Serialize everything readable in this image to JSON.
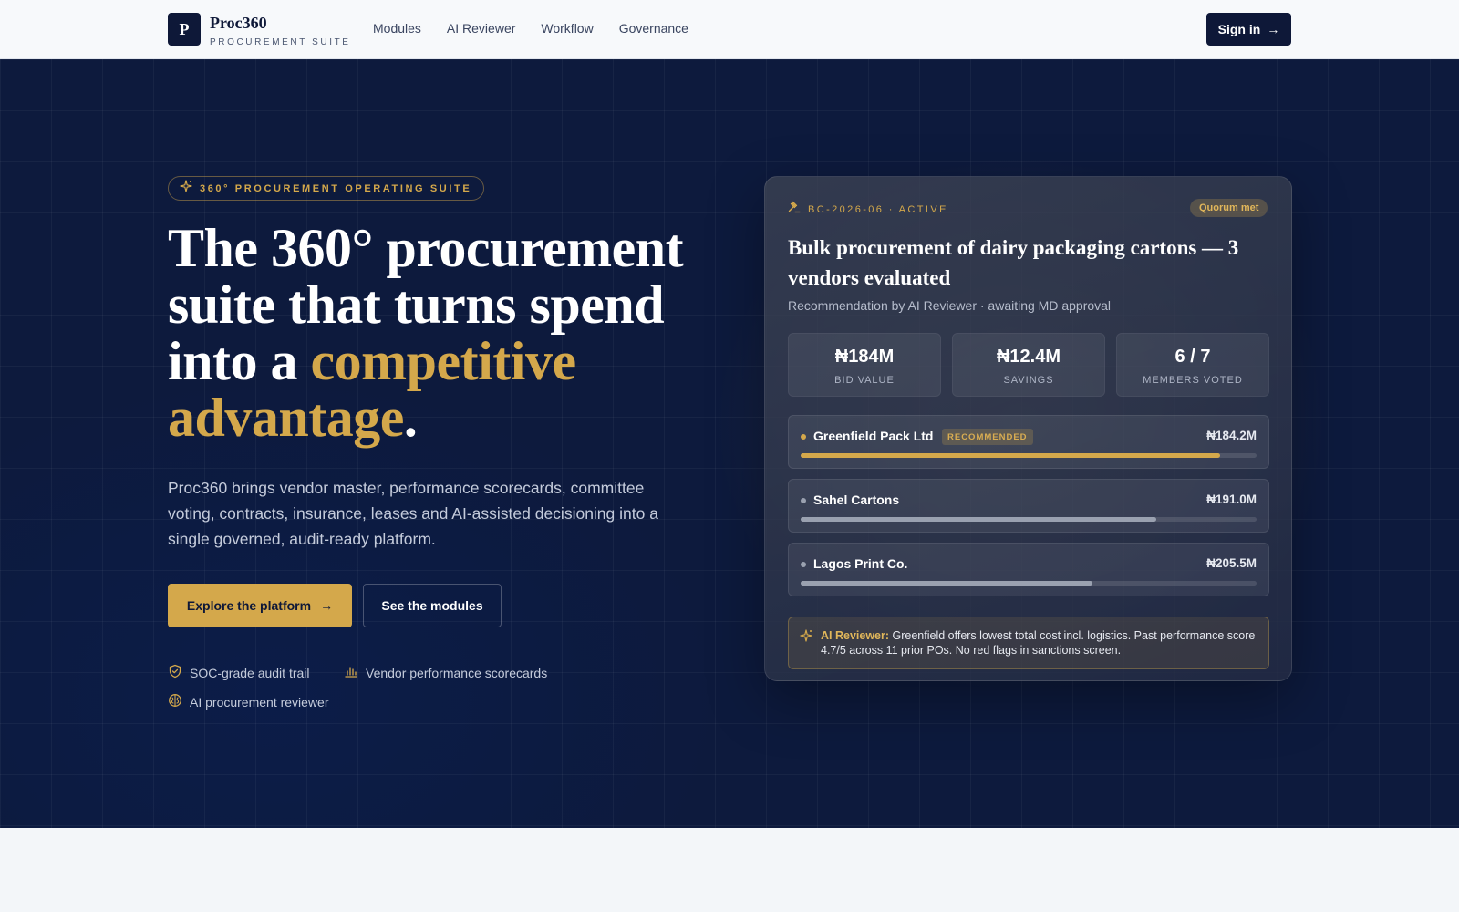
{
  "header": {
    "logo_letter": "P",
    "brand": "Proc360",
    "brand_sub": "PROCUREMENT SUITE",
    "nav": [
      "Modules",
      "AI Reviewer",
      "Workflow",
      "Governance"
    ],
    "signin_label": "Sign in",
    "signin_arrow": "→"
  },
  "hero": {
    "pill": "360° PROCUREMENT OPERATING SUITE",
    "headline_pre": "The 360° procurement suite that turns spend into a ",
    "headline_accent": "competitive advantage",
    "headline_post": ".",
    "lede": "Proc360 brings vendor master, performance scorecards, committee voting, contracts, insurance, leases and AI-assisted decisioning into a single governed, audit-ready platform.",
    "primary_cta": "Explore the platform",
    "primary_arrow": "→",
    "secondary_cta": "See the modules",
    "features": [
      "SOC-grade audit trail",
      "Vendor performance scorecards",
      "AI procurement reviewer"
    ]
  },
  "card": {
    "tag": "BC-2026-06 · ACTIVE",
    "quorum": "Quorum met",
    "title": "Bulk procurement of dairy packaging cartons — 3 vendors evaluated",
    "subtitle": "Recommendation by AI Reviewer · awaiting MD approval",
    "stats": [
      {
        "value": "₦184M",
        "label": "BID VALUE"
      },
      {
        "value": "₦12.4M",
        "label": "SAVINGS"
      },
      {
        "value": "6 / 7",
        "label": "MEMBERS VOTED"
      }
    ],
    "vendors": [
      {
        "name": "Greenfield Pack Ltd",
        "badge": "RECOMMENDED",
        "amount": "₦184.2M",
        "score": 0.92
      },
      {
        "name": "Sahel Cartons",
        "badge": "",
        "amount": "₦191.0M",
        "score": 0.78
      },
      {
        "name": "Lagos Print Co.",
        "badge": "",
        "amount": "₦205.5M",
        "score": 0.64
      }
    ],
    "ai_label": "AI Reviewer:",
    "ai_text": " Greenfield offers lowest total cost incl. logistics. Past performance score 4.7/5 across 11 prior POs. No red flags in sanctions screen."
  },
  "colors": {
    "navy": "#0e1838",
    "gold": "#d4a84b",
    "hero_bg": "#0d1a3d",
    "bar_recommended": "#d4a84b",
    "bar_other": "#9aa1b0"
  }
}
